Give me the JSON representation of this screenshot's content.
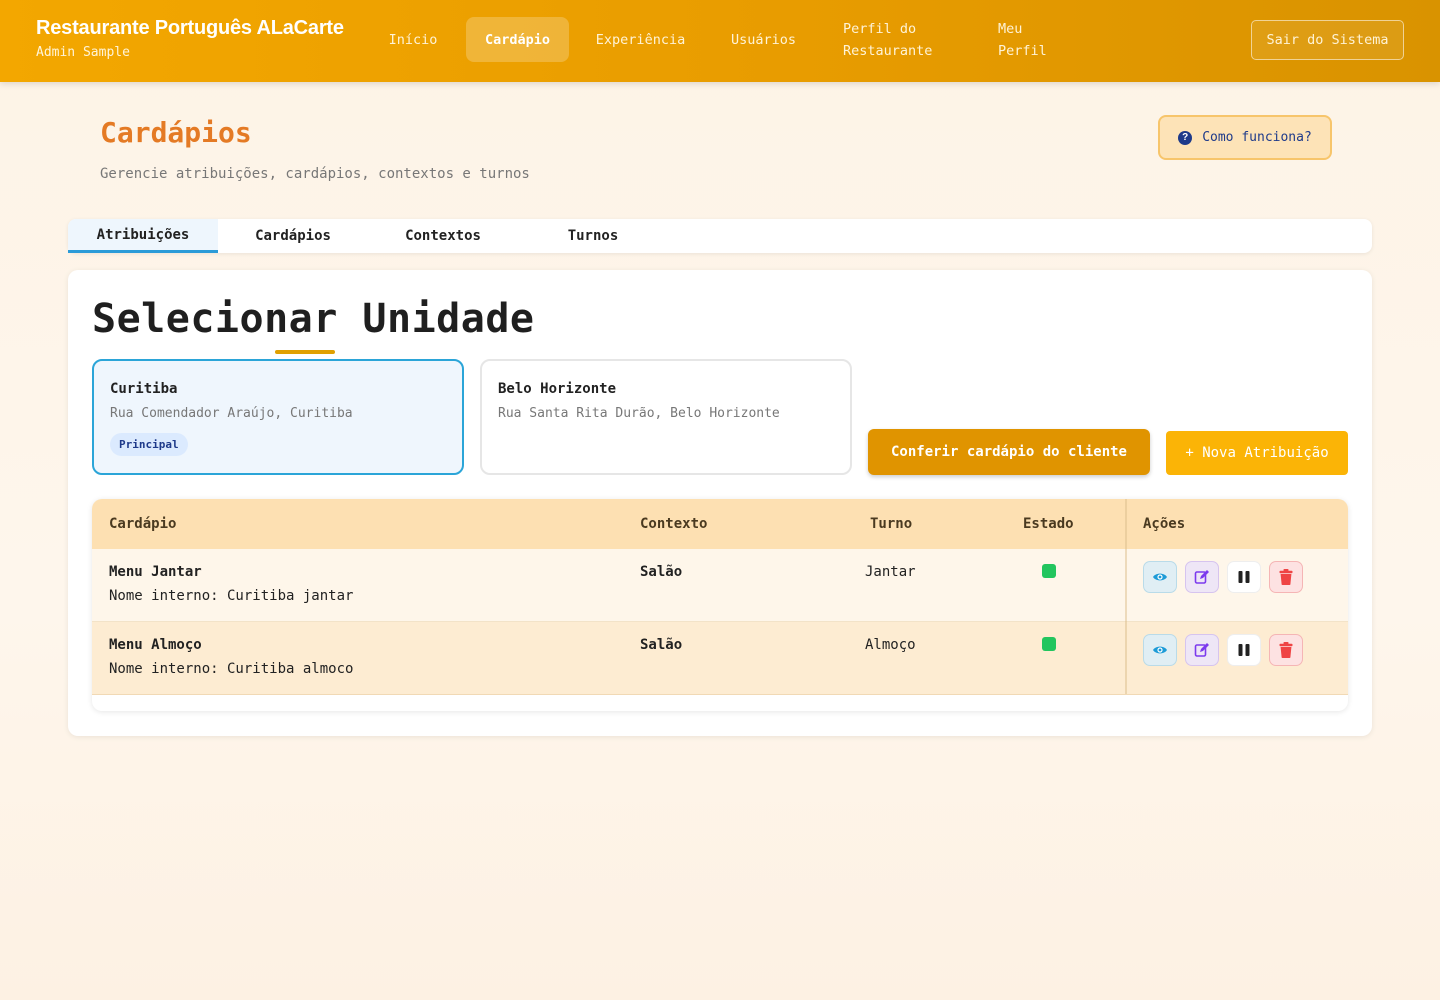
{
  "header": {
    "brand_title": "Restaurante Português ALaCarte",
    "brand_subtitle": "Admin Sample",
    "nav": [
      {
        "label": "Início",
        "active": false
      },
      {
        "label": "Cardápio",
        "active": true
      },
      {
        "label": "Experiência",
        "active": false
      },
      {
        "label": "Usuários",
        "active": false
      },
      {
        "label": "Perfil do Restaurante",
        "active": false
      },
      {
        "label": "Meu Perfil",
        "active": false
      }
    ],
    "logout_label": "Sair do Sistema"
  },
  "page": {
    "title": "Cardápios",
    "subtitle": "Gerencie atribuições, cardápios, contextos e turnos",
    "help_label": "Como funciona?"
  },
  "tabs": [
    {
      "label": "Atribuições",
      "active": true
    },
    {
      "label": "Cardápios",
      "active": false
    },
    {
      "label": "Contextos",
      "active": false
    },
    {
      "label": "Turnos",
      "active": false
    }
  ],
  "units": {
    "section_title": "Selecionar Unidade",
    "items": [
      {
        "name": "Curitiba",
        "address": "Rua Comendador Araújo, Curitiba",
        "badge": "Principal",
        "selected": true
      },
      {
        "name": "Belo Horizonte",
        "address": "Rua Santa Rita Durão, Belo Horizonte",
        "badge": "",
        "selected": false
      }
    ],
    "client_menu_button": "Conferir cardápio do cliente",
    "new_assignment_button": "+ Nova Atribuição"
  },
  "table": {
    "columns": [
      "Cardápio",
      "Contexto",
      "Turno",
      "Estado",
      "Ações"
    ],
    "rows": [
      {
        "menu": "Menu Jantar",
        "internal": "Nome interno: Curitiba jantar",
        "context": "Salão",
        "shift": "Jantar",
        "status": "active"
      },
      {
        "menu": "Menu Almoço",
        "internal": "Nome interno: Curitiba almoco",
        "context": "Salão",
        "shift": "Almoço",
        "status": "active"
      }
    ]
  },
  "colors": {
    "header": "#e89c00",
    "accent": "#e47a24",
    "selected_border": "#2ba5d8",
    "active_status": "#22c55e"
  }
}
